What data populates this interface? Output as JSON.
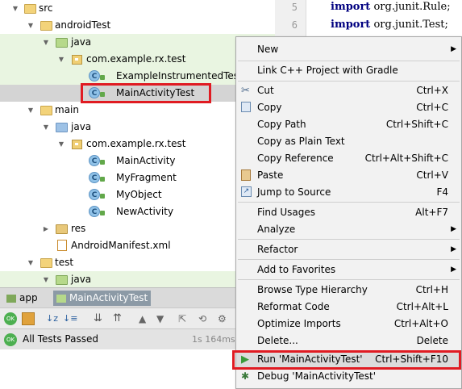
{
  "project_tree": {
    "items": [
      {
        "label": "src"
      },
      {
        "label": "androidTest"
      },
      {
        "label": "java"
      },
      {
        "label": "com.example.rx.test"
      },
      {
        "label": "ExampleInstrumentedTest"
      },
      {
        "label": "MainActivityTest"
      },
      {
        "label": "main"
      },
      {
        "label": "java"
      },
      {
        "label": "com.example.rx.test"
      },
      {
        "label": "MainActivity"
      },
      {
        "label": "MyFragment"
      },
      {
        "label": "MyObject"
      },
      {
        "label": "NewActivity"
      },
      {
        "label": "res"
      },
      {
        "label": "AndroidManifest.xml"
      },
      {
        "label": "test"
      },
      {
        "label": "java"
      }
    ]
  },
  "editor": {
    "lines": [
      {
        "number": "5",
        "keyword": "import",
        "code": "org.junit.Rule;"
      },
      {
        "number": "6",
        "keyword": "import",
        "code": "org.junit.Test;"
      }
    ]
  },
  "bottom_tabs": {
    "app": "app",
    "test_run": "MainActivityTest"
  },
  "test_status": {
    "text": "All Tests Passed",
    "duration": "1s 164ms"
  },
  "context_menu": {
    "items": [
      {
        "label": "New"
      },
      {
        "label": "Link C++ Project with Gradle"
      },
      {
        "label": "Cut",
        "shortcut": "Ctrl+X"
      },
      {
        "label": "Copy",
        "shortcut": "Ctrl+C"
      },
      {
        "label": "Copy Path",
        "shortcut": "Ctrl+Shift+C"
      },
      {
        "label": "Copy as Plain Text"
      },
      {
        "label": "Copy Reference",
        "shortcut": "Ctrl+Alt+Shift+C"
      },
      {
        "label": "Paste",
        "shortcut": "Ctrl+V"
      },
      {
        "label": "Jump to Source",
        "shortcut": "F4"
      },
      {
        "label": "Find Usages",
        "shortcut": "Alt+F7"
      },
      {
        "label": "Analyze"
      },
      {
        "label": "Refactor"
      },
      {
        "label": "Add to Favorites"
      },
      {
        "label": "Browse Type Hierarchy",
        "shortcut": "Ctrl+H"
      },
      {
        "label": "Reformat Code",
        "shortcut": "Ctrl+Alt+L"
      },
      {
        "label": "Optimize Imports",
        "shortcut": "Ctrl+Alt+O"
      },
      {
        "label": "Delete...",
        "shortcut": "Delete"
      },
      {
        "label": "Run 'MainActivityTest'",
        "shortcut": "Ctrl+Shift+F10"
      },
      {
        "label": "Debug 'MainActivityTest'"
      }
    ]
  },
  "colors": {
    "highlight_border": "#e01b22",
    "run_icon": "#3a9a3a",
    "test_pass": "#4caf50"
  }
}
